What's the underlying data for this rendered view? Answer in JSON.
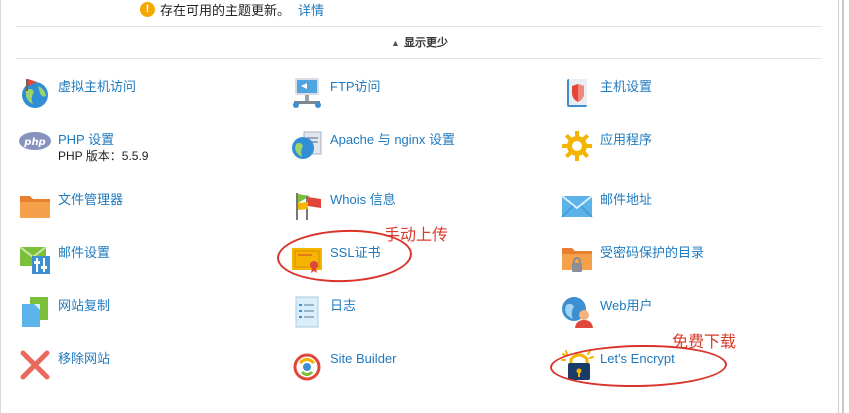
{
  "notice": {
    "icon": "warning-icon",
    "text": "存在可用的主题更新。",
    "link_label": "详情"
  },
  "toggle": {
    "label": "显示更少",
    "icon": "chevron-up-icon"
  },
  "items": [
    {
      "key": "virtual-host",
      "label": "虚拟主机访问",
      "icon": "globe-flag-icon"
    },
    {
      "key": "ftp",
      "label": "FTP访问",
      "icon": "ftp-icon"
    },
    {
      "key": "host-settings",
      "label": "主机设置",
      "icon": "shield-book-icon"
    },
    {
      "key": "php",
      "label": "PHP 设置",
      "sublabel": "PHP 版本：5.5.9",
      "icon": "php-icon"
    },
    {
      "key": "apache",
      "label": "Apache 与 nginx 设置",
      "icon": "globe-document-icon"
    },
    {
      "key": "apps",
      "label": "应用程序",
      "icon": "gear-icon"
    },
    {
      "key": "file-manager",
      "label": "文件管理器",
      "icon": "folder-icon"
    },
    {
      "key": "whois",
      "label": "Whois 信息",
      "icon": "flags-icon"
    },
    {
      "key": "mail-address",
      "label": "邮件地址",
      "icon": "envelope-icon"
    },
    {
      "key": "mail-settings",
      "label": "邮件设置",
      "icon": "envelope-sliders-icon"
    },
    {
      "key": "ssl",
      "label": "SSL证书",
      "icon": "certificate-icon"
    },
    {
      "key": "protected-dir",
      "label": "受密码保护的目录",
      "icon": "folder-lock-icon"
    },
    {
      "key": "site-copy",
      "label": "网站复制",
      "icon": "copy-pages-icon"
    },
    {
      "key": "logs",
      "label": "日志",
      "icon": "log-document-icon"
    },
    {
      "key": "web-users",
      "label": "Web用户",
      "icon": "globe-user-icon"
    },
    {
      "key": "remove-site",
      "label": "移除网站",
      "icon": "remove-x-icon"
    },
    {
      "key": "site-builder",
      "label": "Site Builder",
      "icon": "site-builder-icon"
    },
    {
      "key": "lets-encrypt",
      "label": "Let's Encrypt",
      "icon": "padlock-sparkle-icon"
    }
  ],
  "annotations": {
    "ssl_note": "手动上传",
    "le_note": "免费下载"
  },
  "colors": {
    "link": "#1e7abf",
    "annotation": "#d93a2b",
    "warning": "#f4a900"
  }
}
